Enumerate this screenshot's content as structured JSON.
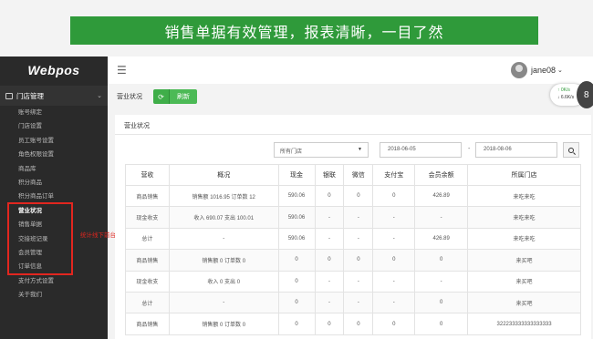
{
  "banner": "销售单据有效管理，报表清晰，一目了然",
  "sidebar": {
    "logo": "Webpos",
    "group": "门店管理",
    "items": [
      "账号绑定",
      "门店设置",
      "员工账号设置",
      "角色权限设置",
      "商品库",
      "积分商品",
      "积分商品订单",
      "营业状况",
      "销售单据",
      "交接班记录",
      "会员管理",
      "订单信息",
      "支付方式设置",
      "关于我们"
    ]
  },
  "annotation": "统计线下前台信息",
  "header": {
    "username": "jane08",
    "caret": "⌄"
  },
  "speed": {
    "up": "↑ 0K/s",
    "down": "↓ 6.6K/s",
    "badge": "8"
  },
  "toolbar": {
    "crumb": "营业状况",
    "refresh": "刷新"
  },
  "panel": {
    "title": "营业状况"
  },
  "filters": {
    "store": "所有门店",
    "date_from": "2018-06-05",
    "dash": "-",
    "date_to": "2018-08-06"
  },
  "table": {
    "headers": [
      "营收",
      "概况",
      "现金",
      "银联",
      "微信",
      "支付宝",
      "会员余额",
      "所属门店"
    ],
    "rows": [
      [
        "商品销售",
        "销售额 1016.95 订单数 12",
        "590.06",
        "0",
        "0",
        "0",
        "426.89",
        "来吃来吃"
      ],
      [
        "现金收支",
        "收入 690.07 支出 100.01",
        "590.06",
        "-",
        "-",
        "-",
        "-",
        "来吃来吃"
      ],
      [
        "总计",
        "-",
        "590.06",
        "-",
        "-",
        "-",
        "426.89",
        "来吃来吃"
      ],
      [
        "商品销售",
        "销售额 0 订单数 0",
        "0",
        "0",
        "0",
        "0",
        "0",
        "来买吧"
      ],
      [
        "现金收支",
        "收入 0 支出 0",
        "0",
        "-",
        "-",
        "-",
        "-",
        "来买吧"
      ],
      [
        "总计",
        "-",
        "0",
        "-",
        "-",
        "-",
        "0",
        "来买吧"
      ],
      [
        "商品销售",
        "销售额 0 订单数 0",
        "0",
        "0",
        "0",
        "0",
        "0",
        "322233333333333333"
      ]
    ]
  },
  "colors": {
    "accent": "#2f9a3a",
    "highlight": "#e2261f",
    "sidebar": "#2a2a2a"
  }
}
